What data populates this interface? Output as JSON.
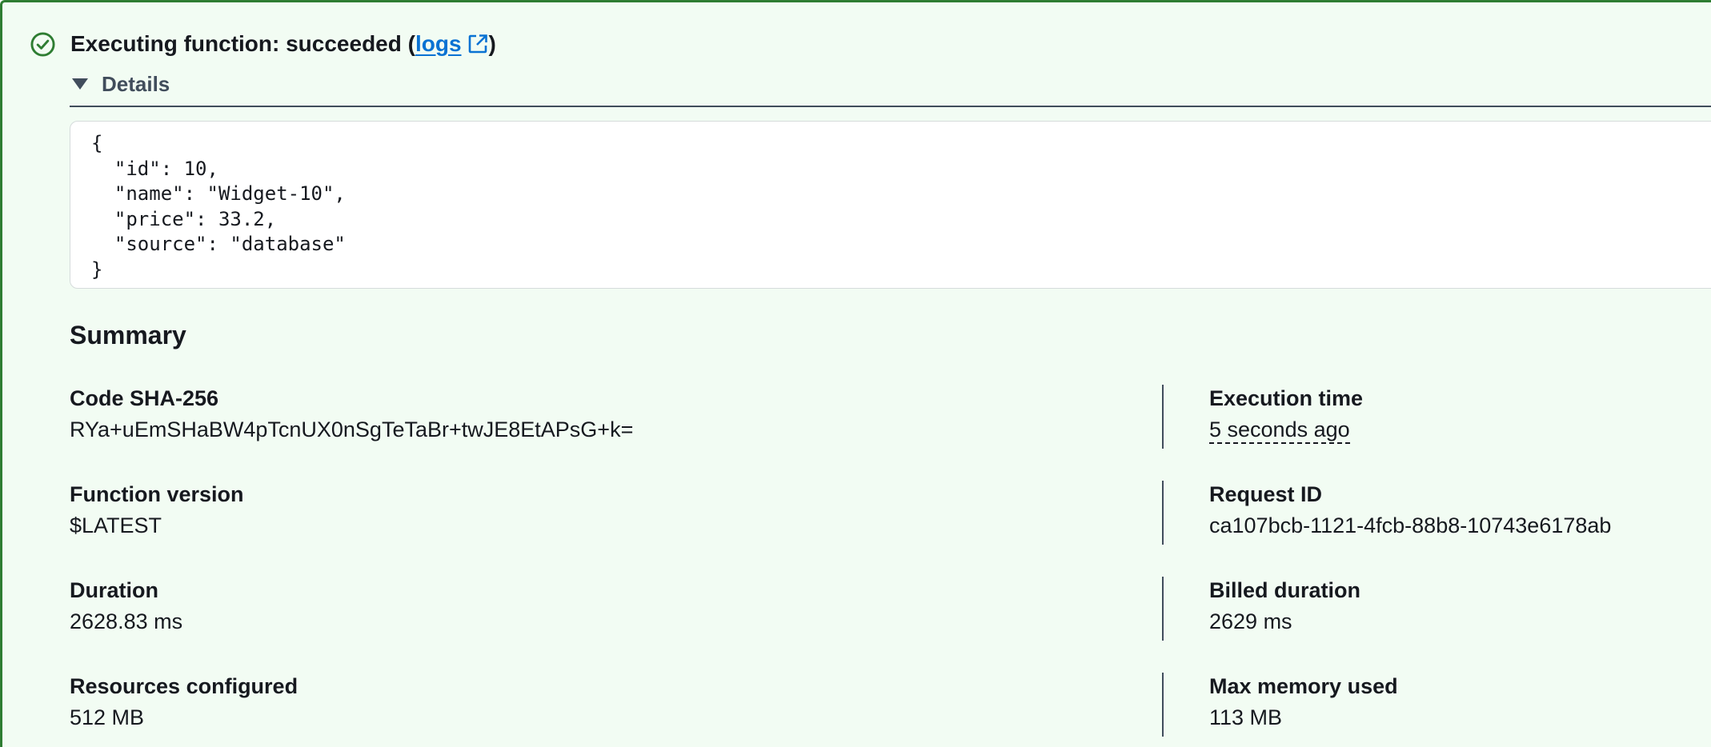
{
  "header": {
    "prefix": "Executing function: succeeded (",
    "link_label": "logs",
    "suffix": ")"
  },
  "details": {
    "label": "Details"
  },
  "output": {
    "code": "{\n  \"id\": 10,\n  \"name\": \"Widget-10\",\n  \"price\": 33.2,\n  \"source\": \"database\"\n}"
  },
  "summary": {
    "title": "Summary",
    "rows": [
      {
        "left_label": "Code SHA-256",
        "left_value": "RYa+uEmSHaBW4pTcnUX0nSgTeTaBr+twJE8EtAPsG+k=",
        "right_label": "Execution time",
        "right_value": "5 seconds ago"
      },
      {
        "left_label": "Function version",
        "left_value": "$LATEST",
        "right_label": "Request ID",
        "right_value": "ca107bcb-1121-4fcb-88b8-10743e6178ab"
      },
      {
        "left_label": "Duration",
        "left_value": "2628.83 ms",
        "right_label": "Billed duration",
        "right_value": "2629 ms"
      },
      {
        "left_label": "Resources configured",
        "left_value": "512 MB",
        "right_label": "Max memory used",
        "right_value": "113 MB"
      }
    ]
  },
  "icons": {
    "status": "check-circle-icon",
    "external": "external-link-icon",
    "caret": "caret-down-icon"
  },
  "colors": {
    "success": "#2e7d32",
    "background": "#f2fcf3",
    "link": "#0972d3",
    "text": "#16191f",
    "muted": "#414d5c"
  }
}
